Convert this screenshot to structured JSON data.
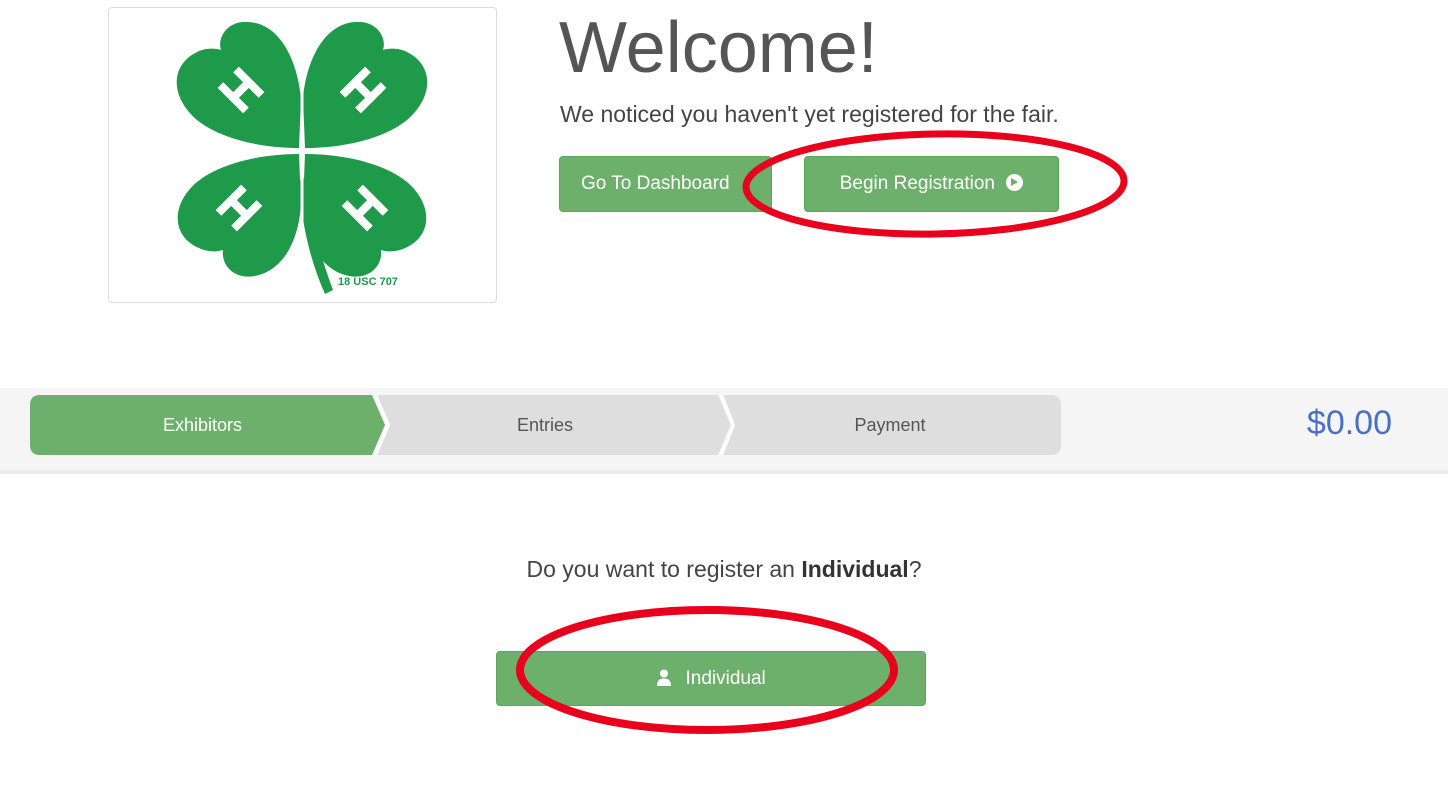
{
  "logo": {
    "icon": "four-h-clover-logo",
    "caption": "18 USC 707",
    "color": "#1f9a4a"
  },
  "welcome": {
    "title": "Welcome!",
    "subtitle": "We noticed you haven't yet registered for the fair.",
    "dashboard_button": "Go To Dashboard",
    "begin_button": "Begin Registration"
  },
  "steps": {
    "items": [
      {
        "label": "Exhibitors",
        "active": true
      },
      {
        "label": "Entries",
        "active": false
      },
      {
        "label": "Payment",
        "active": false
      }
    ],
    "total": "$0.00"
  },
  "register": {
    "question_prefix": "Do you want to register an ",
    "question_bold": "Individual",
    "question_suffix": "?",
    "individual_button": "Individual"
  },
  "colors": {
    "accent_green": "#6db06c",
    "inactive_step": "#dedede",
    "total_blue": "#4a6fc6",
    "annotation_red": "#e8001c"
  }
}
